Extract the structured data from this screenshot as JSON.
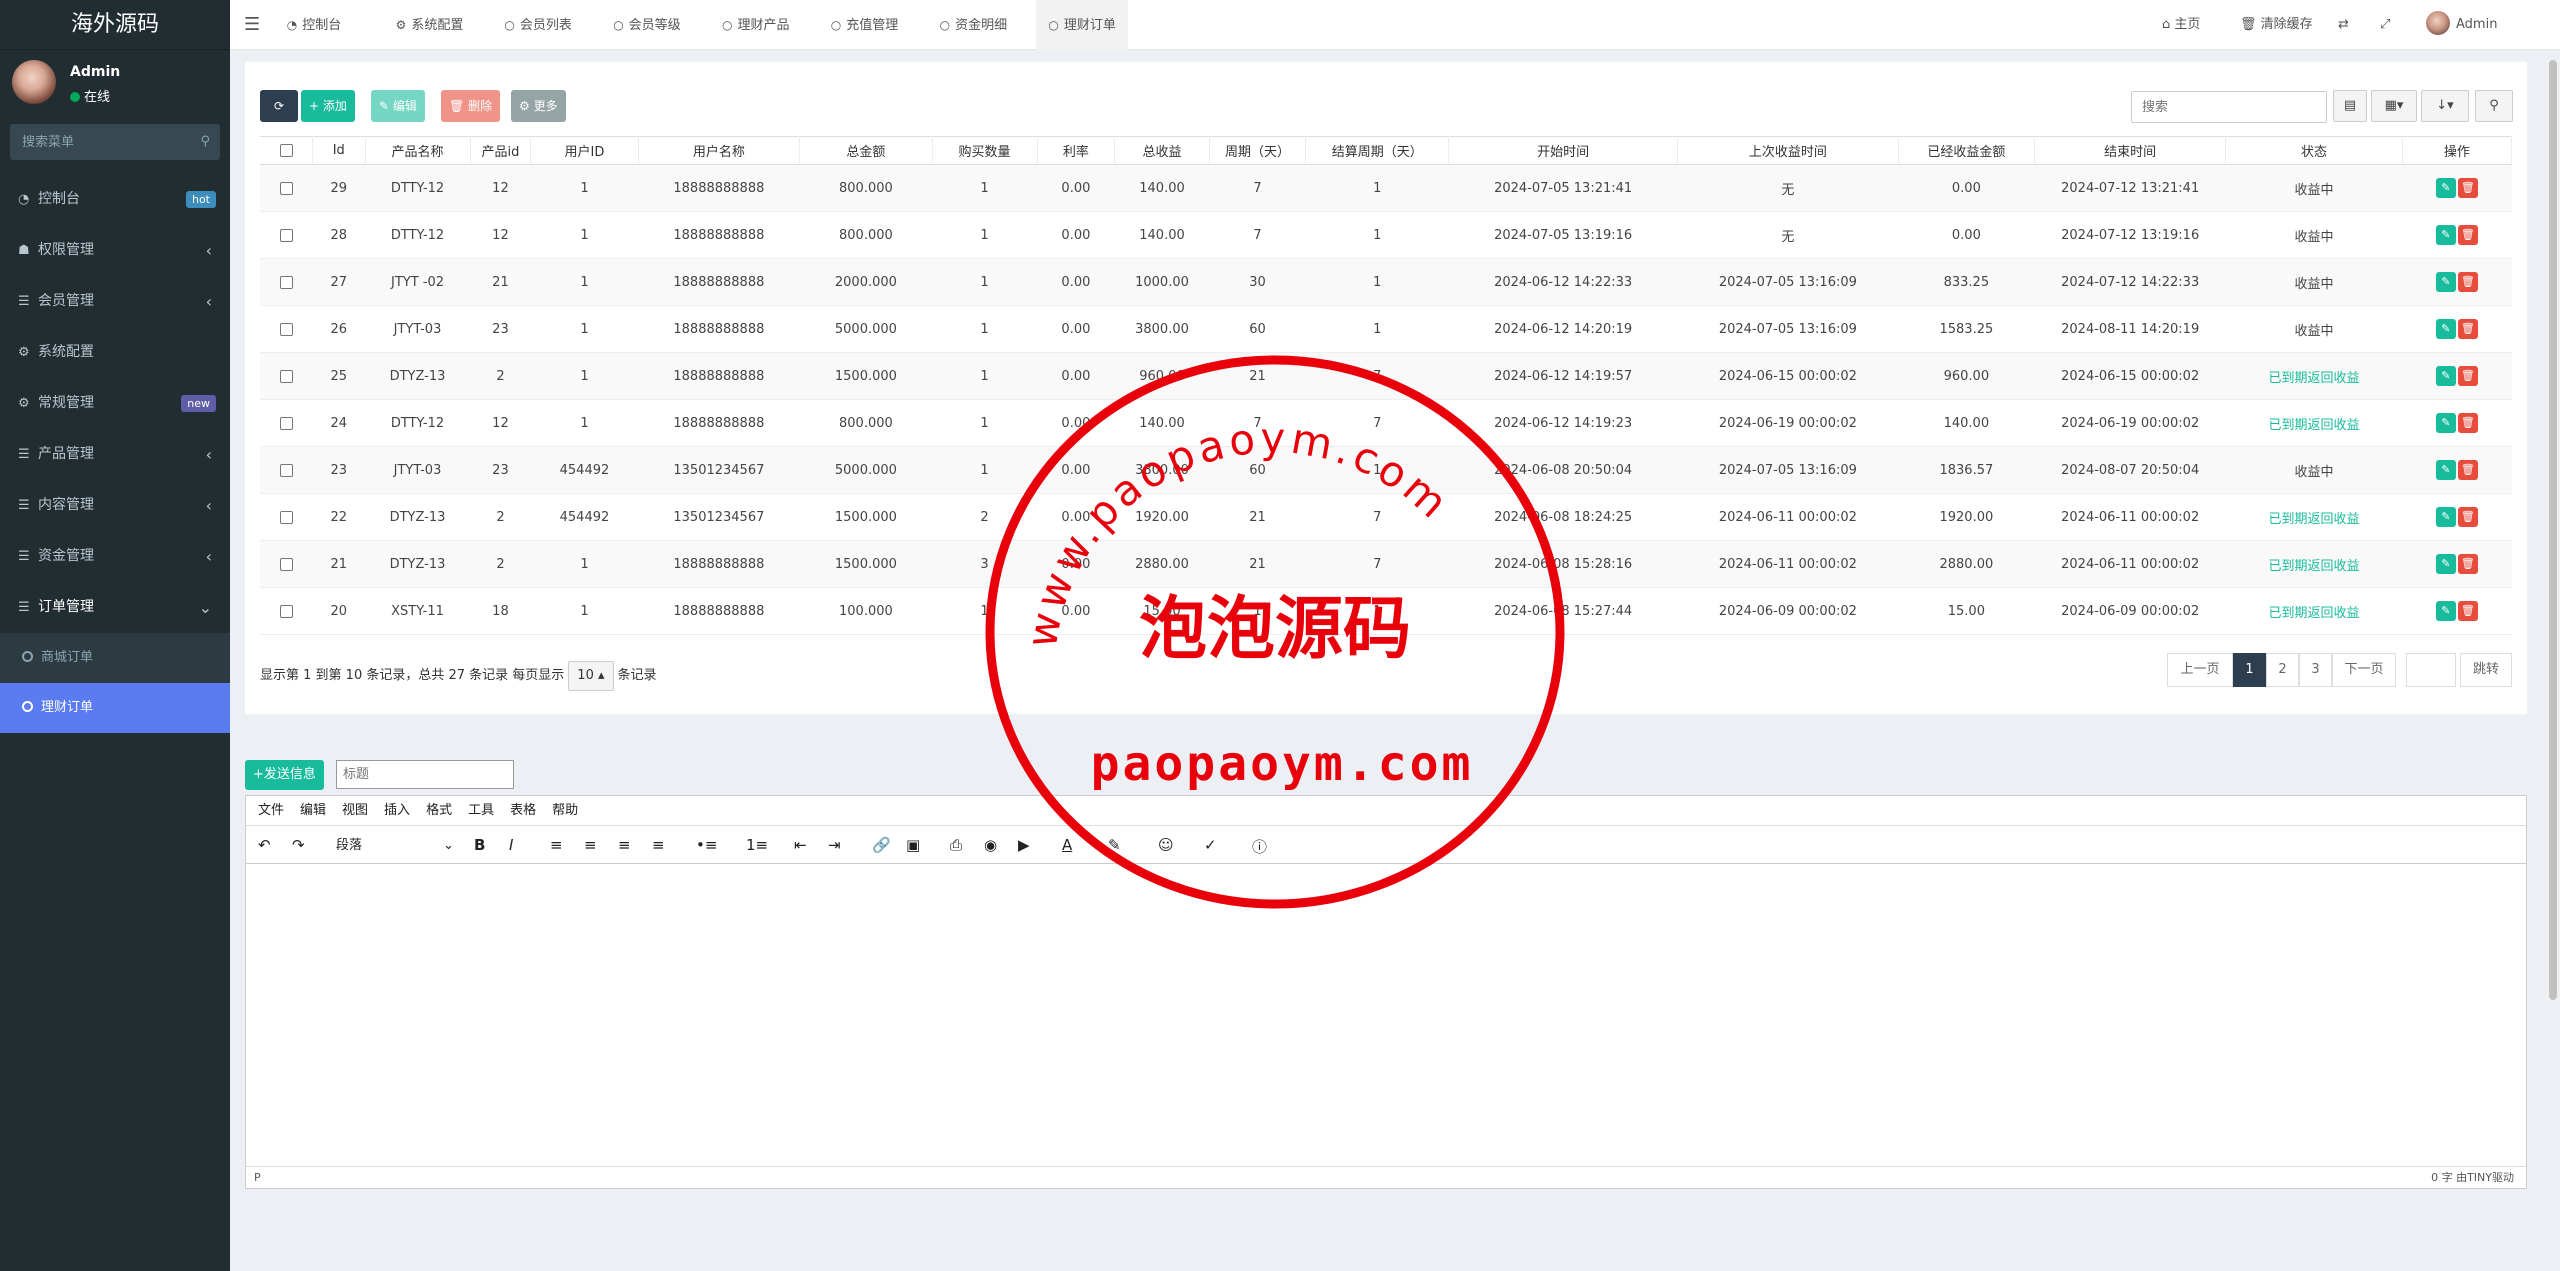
{
  "sidebar": {
    "logo": "海外源码",
    "user_name": "Admin",
    "user_status": "在线",
    "search_placeholder": "搜索菜单",
    "items": [
      {
        "label": "控制台",
        "icon": "dashboard-icon",
        "badge": "hot"
      },
      {
        "label": "权限管理",
        "icon": "users-icon"
      },
      {
        "label": "会员管理",
        "icon": "list-icon"
      },
      {
        "label": "系统配置",
        "icon": "gear-icon"
      },
      {
        "label": "常规管理",
        "icon": "cogs-icon",
        "badge": "new"
      },
      {
        "label": "产品管理",
        "icon": "list-icon"
      },
      {
        "label": "内容管理",
        "icon": "list-icon"
      },
      {
        "label": "资金管理",
        "icon": "list-icon"
      },
      {
        "label": "订单管理",
        "icon": "list-icon"
      }
    ],
    "sub_items": [
      "商城订单",
      "理财订单"
    ]
  },
  "header": {
    "tabs": [
      "控制台",
      "系统配置",
      "会员列表",
      "会员等级",
      "理财产品",
      "充值管理",
      "资金明细",
      "理财订单"
    ],
    "home": "主页",
    "clear_cache": "清除缓存",
    "admin": "Admin"
  },
  "toolbar": {
    "add": "添加",
    "edit": "编辑",
    "delete": "删除",
    "more": "更多",
    "search_placeholder": "搜索"
  },
  "table": {
    "columns": [
      "Id",
      "产品名称",
      "产品id",
      "用户ID",
      "用户名称",
      "总金额",
      "购买数量",
      "利率",
      "总收益",
      "周期（天）",
      "结算周期（天）",
      "开始时间",
      "上次收益时间",
      "已经收益金额",
      "结束时间",
      "状态",
      "操作"
    ],
    "rows": [
      [
        "29",
        "DTTY-12",
        "12",
        "1",
        "18888888888",
        "800.000",
        "1",
        "0.00",
        "140.00",
        "7",
        "1",
        "2024-07-05 13:21:41",
        "无",
        "0.00",
        "2024-07-12 13:21:41",
        "收益中"
      ],
      [
        "28",
        "DTTY-12",
        "12",
        "1",
        "18888888888",
        "800.000",
        "1",
        "0.00",
        "140.00",
        "7",
        "1",
        "2024-07-05 13:19:16",
        "无",
        "0.00",
        "2024-07-12 13:19:16",
        "收益中"
      ],
      [
        "27",
        "JTYT -02",
        "21",
        "1",
        "18888888888",
        "2000.000",
        "1",
        "0.00",
        "1000.00",
        "30",
        "1",
        "2024-06-12 14:22:33",
        "2024-07-05 13:16:09",
        "833.25",
        "2024-07-12 14:22:33",
        "收益中"
      ],
      [
        "26",
        "JTYT-03",
        "23",
        "1",
        "18888888888",
        "5000.000",
        "1",
        "0.00",
        "3800.00",
        "60",
        "1",
        "2024-06-12 14:20:19",
        "2024-07-05 13:16:09",
        "1583.25",
        "2024-08-11 14:20:19",
        "收益中"
      ],
      [
        "25",
        "DTYZ-13",
        "2",
        "1",
        "18888888888",
        "1500.000",
        "1",
        "0.00",
        "960.00",
        "21",
        "7",
        "2024-06-12 14:19:57",
        "2024-06-15 00:00:02",
        "960.00",
        "2024-06-15 00:00:02",
        "已到期返回收益"
      ],
      [
        "24",
        "DTTY-12",
        "12",
        "1",
        "18888888888",
        "800.000",
        "1",
        "0.00",
        "140.00",
        "7",
        "7",
        "2024-06-12 14:19:23",
        "2024-06-19 00:00:02",
        "140.00",
        "2024-06-19 00:00:02",
        "已到期返回收益"
      ],
      [
        "23",
        "JTYT-03",
        "23",
        "454492",
        "13501234567",
        "5000.000",
        "1",
        "0.00",
        "3800.00",
        "60",
        "1",
        "2024-06-08 20:50:04",
        "2024-07-05 13:16:09",
        "1836.57",
        "2024-08-07 20:50:04",
        "收益中"
      ],
      [
        "22",
        "DTYZ-13",
        "2",
        "454492",
        "13501234567",
        "1500.000",
        "2",
        "0.00",
        "1920.00",
        "21",
        "7",
        "2024-06-08 18:24:25",
        "2024-06-11 00:00:02",
        "1920.00",
        "2024-06-11 00:00:02",
        "已到期返回收益"
      ],
      [
        "21",
        "DTYZ-13",
        "2",
        "1",
        "18888888888",
        "1500.000",
        "3",
        "0.00",
        "2880.00",
        "21",
        "7",
        "2024-06-08 15:28:16",
        "2024-06-11 00:00:02",
        "2880.00",
        "2024-06-11 00:00:02",
        "已到期返回收益"
      ],
      [
        "20",
        "XSTY-11",
        "18",
        "1",
        "18888888888",
        "100.000",
        "1",
        "0.00",
        "15.00",
        "1",
        "1",
        "2024-06-08 15:27:44",
        "2024-06-09 00:00:02",
        "15.00",
        "2024-06-09 00:00:02",
        "已到期返回收益"
      ]
    ]
  },
  "pagination": {
    "info_prefix": "显示第 1 到第 10 条记录，总共 27 条记录 每页显示",
    "page_size": "10",
    "info_suffix": "条记录",
    "prev": "上一页",
    "pages": [
      "1",
      "2",
      "3"
    ],
    "next": "下一页",
    "jump": "跳转"
  },
  "editor": {
    "send": "发送信息",
    "title_placeholder": "标题",
    "menus": [
      "文件",
      "编辑",
      "视图",
      "插入",
      "格式",
      "工具",
      "表格",
      "帮助"
    ],
    "paragraph": "段落",
    "status_left": "P",
    "status_right": "0 字  由TINY驱动"
  },
  "stamp": {
    "url_arc": "www.paopaoym.com",
    "name": "泡泡源码",
    "bottom": "paopaoym.com"
  }
}
